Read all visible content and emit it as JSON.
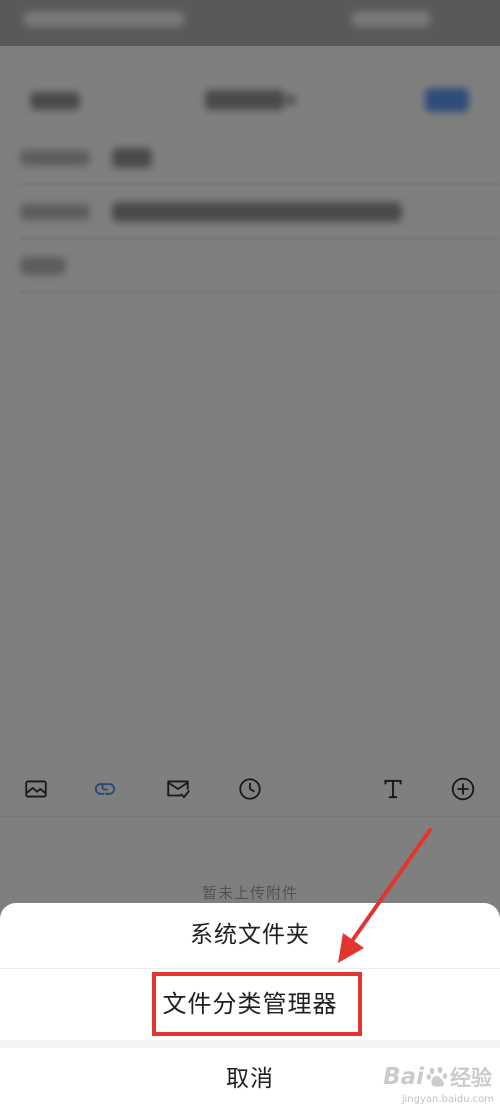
{
  "colors": {
    "accent_blue": "#4d8ef0",
    "annotation_red": "#e3342f",
    "overlay": "rgba(0,0,0,0.5)"
  },
  "compose": {
    "attachments_empty_text": "暂未上传附件"
  },
  "toolbar": {
    "icons": [
      "image-icon",
      "link-icon",
      "mail-check-icon",
      "clock-icon",
      "text-format-icon",
      "add-circle-icon"
    ],
    "active_icon": "link-icon"
  },
  "sheet": {
    "options": [
      {
        "label": "系统文件夹",
        "highlighted": false
      },
      {
        "label": "文件分类管理器",
        "highlighted": true
      }
    ],
    "cancel_label": "取消"
  },
  "watermark": {
    "brand": "Bai",
    "product": "经验",
    "url": "jingyan.baidu.com"
  }
}
